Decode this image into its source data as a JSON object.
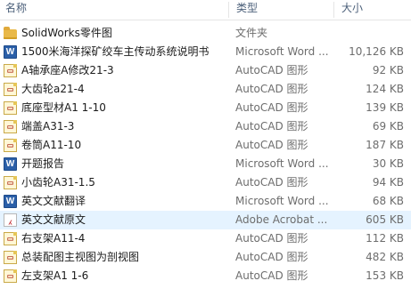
{
  "columns": {
    "name": "名称",
    "type": "类型",
    "size": "大小"
  },
  "files": [
    {
      "name": "SolidWorks零件图",
      "type": "文件夹",
      "size": "",
      "icon": "folder-icon"
    },
    {
      "name": "1500米海洋探矿绞车主传动系统说明书",
      "type": "Microsoft Word ...",
      "size": "10,126 KB",
      "icon": "word-document-icon"
    },
    {
      "name": "A轴承座A修改21-3",
      "type": "AutoCAD 图形",
      "size": "92 KB",
      "icon": "autocad-drawing-icon"
    },
    {
      "name": "大齿轮a21-4",
      "type": "AutoCAD 图形",
      "size": "124 KB",
      "icon": "autocad-drawing-icon"
    },
    {
      "name": "底座型材A1 1-10",
      "type": "AutoCAD 图形",
      "size": "139 KB",
      "icon": "autocad-drawing-icon"
    },
    {
      "name": "端盖A31-3",
      "type": "AutoCAD 图形",
      "size": "69 KB",
      "icon": "autocad-drawing-icon"
    },
    {
      "name": "卷筒A11-10",
      "type": "AutoCAD 图形",
      "size": "187 KB",
      "icon": "autocad-drawing-icon"
    },
    {
      "name": "开题报告",
      "type": "Microsoft Word ...",
      "size": "30 KB",
      "icon": "word-document-icon"
    },
    {
      "name": "小齿轮A31-1.5",
      "type": "AutoCAD 图形",
      "size": "94 KB",
      "icon": "autocad-drawing-icon"
    },
    {
      "name": "英文文献翻译",
      "type": "Microsoft Word ...",
      "size": "68 KB",
      "icon": "word-document-icon"
    },
    {
      "name": "英文文献原文",
      "type": "Adobe Acrobat ...",
      "size": "605 KB",
      "icon": "pdf-document-icon",
      "selected": true
    },
    {
      "name": "右支架A11-4",
      "type": "AutoCAD 图形",
      "size": "112 KB",
      "icon": "autocad-drawing-icon"
    },
    {
      "name": "总装配图主视图为剖视图",
      "type": "AutoCAD 图形",
      "size": "482 KB",
      "icon": "autocad-drawing-icon"
    },
    {
      "name": "左支架A1 1-6",
      "type": "AutoCAD 图形",
      "size": "153 KB",
      "icon": "autocad-drawing-icon"
    }
  ],
  "icon_glyphs": {
    "word": "W",
    "pdf": "⁁",
    "dwg": "▭"
  },
  "colors": {
    "selected_row": "#e5f3ff",
    "header_text": "#4c607a",
    "folder": "#e9b949",
    "word": "#2b5fa8",
    "pdf": "#c0282d"
  }
}
